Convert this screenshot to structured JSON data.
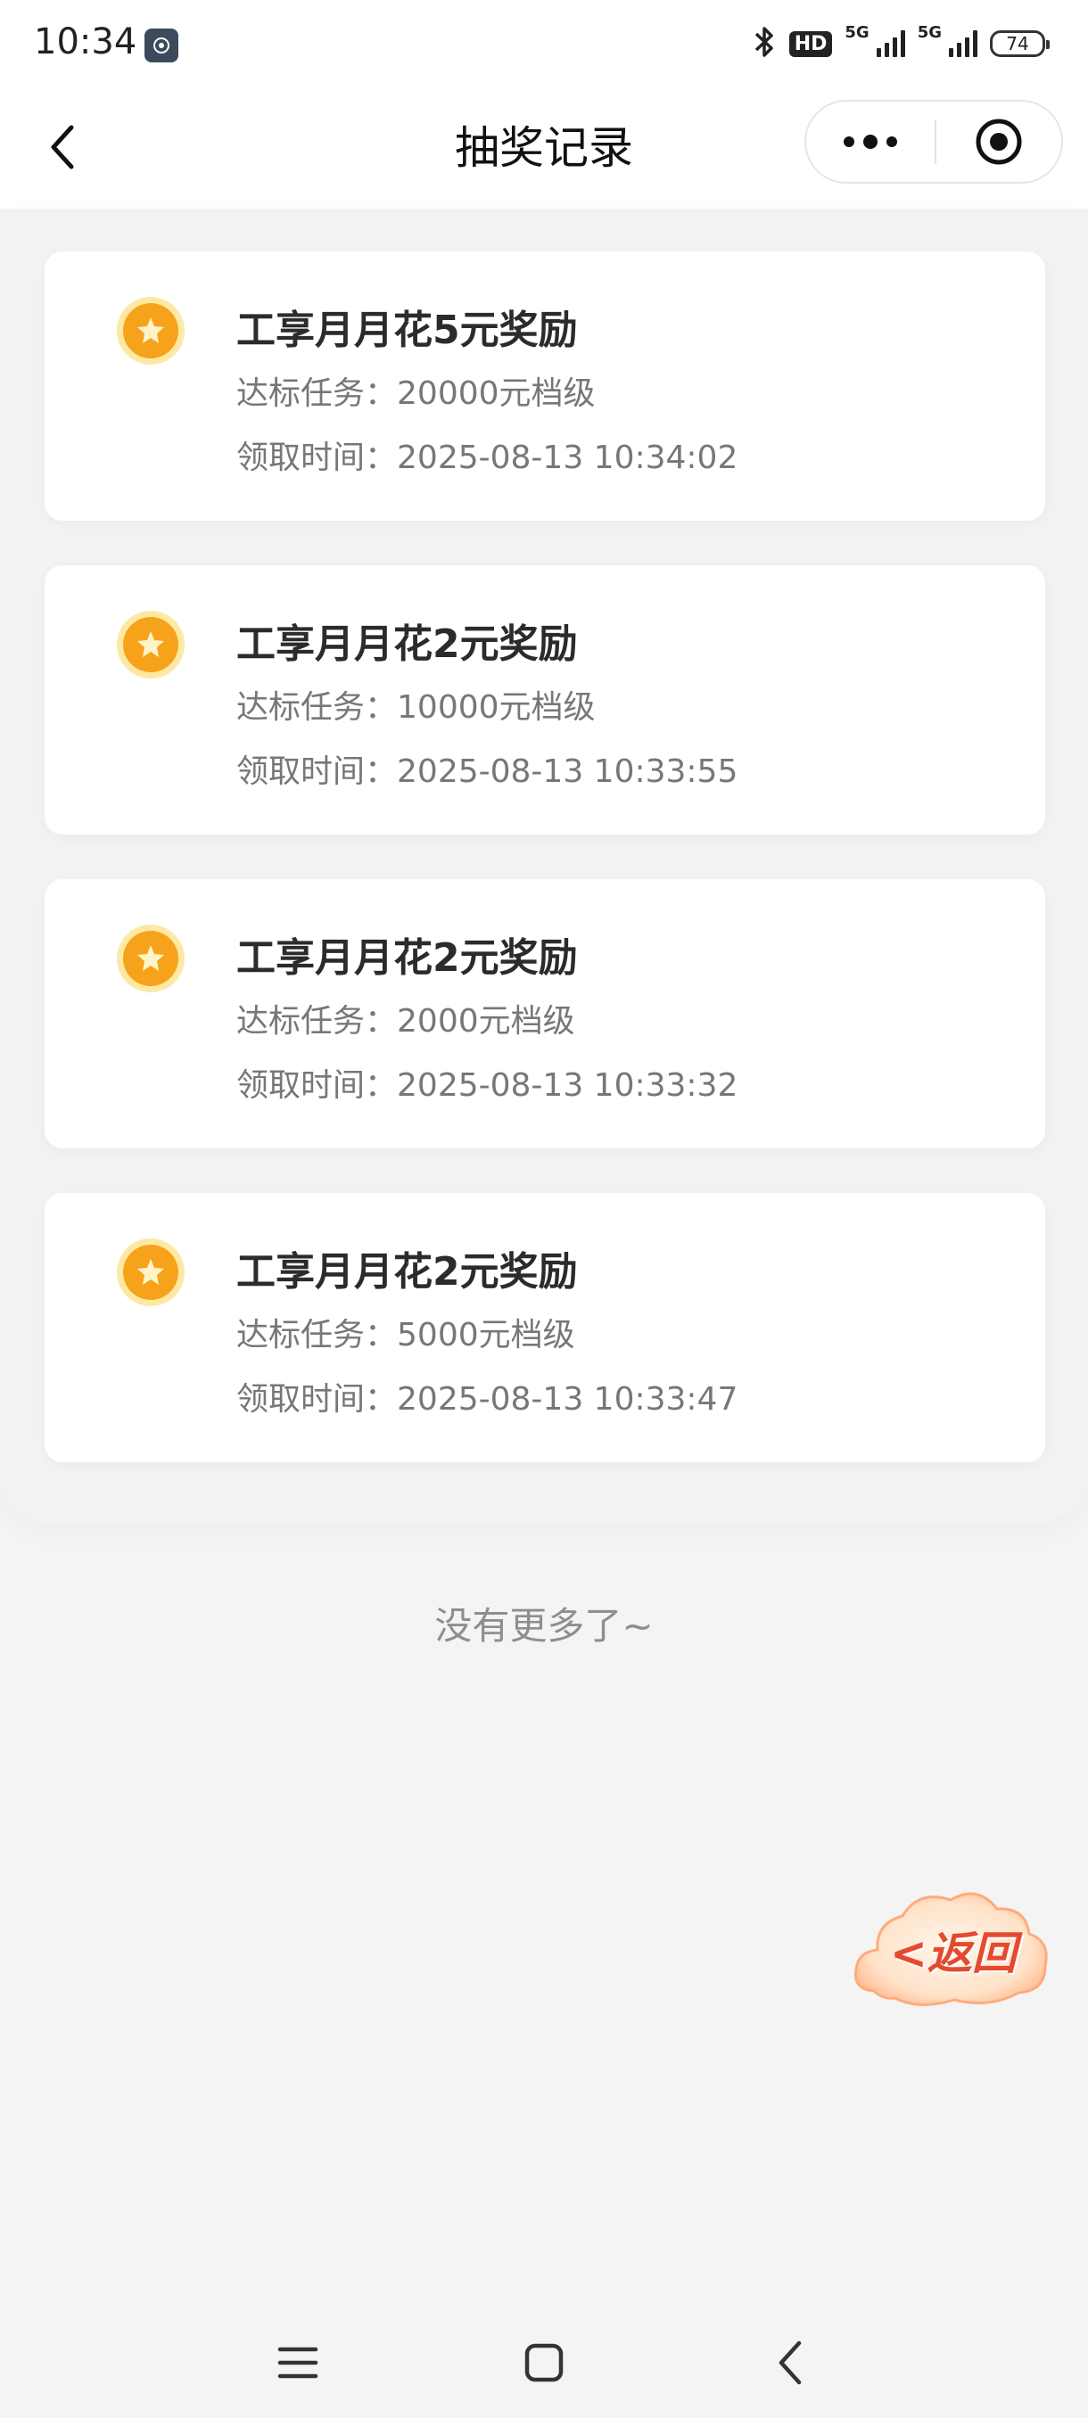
{
  "status_bar": {
    "time": "10:34",
    "hd_label": "HD",
    "network_1": "5G",
    "network_2": "5G",
    "battery": "74",
    "icons": [
      "app-notification-icon",
      "bluetooth-icon",
      "hd-voice-icon",
      "signal-icon",
      "signal-icon",
      "battery-icon"
    ]
  },
  "nav": {
    "title": "抽奖记录",
    "back_icon": "chevron-left-icon",
    "more_icon": "more-dots-icon",
    "close_icon": "target-close-icon"
  },
  "records": [
    {
      "title": "工享月月花5元奖励",
      "task_label": "达标任务：",
      "task_value": "20000元档级",
      "time_label": "领取时间：",
      "time_value": "2025-08-13 10:34:02"
    },
    {
      "title": "工享月月花2元奖励",
      "task_label": "达标任务：",
      "task_value": "10000元档级",
      "time_label": "领取时间：",
      "time_value": "2025-08-13 10:33:55"
    },
    {
      "title": "工享月月花2元奖励",
      "task_label": "达标任务：",
      "task_value": "2000元档级",
      "time_label": "领取时间：",
      "time_value": "2025-08-13 10:33:32"
    },
    {
      "title": "工享月月花2元奖励",
      "task_label": "达标任务：",
      "task_value": "5000元档级",
      "time_label": "领取时间：",
      "time_value": "2025-08-13 10:33:47"
    }
  ],
  "footer_text": "没有更多了~",
  "return_button": {
    "label": "<返回"
  },
  "system_nav": {
    "icons": [
      "menu-icon",
      "home-icon",
      "back-icon"
    ]
  },
  "colors": {
    "accent": "#f7a21b",
    "return_text": "#e34a2f"
  }
}
